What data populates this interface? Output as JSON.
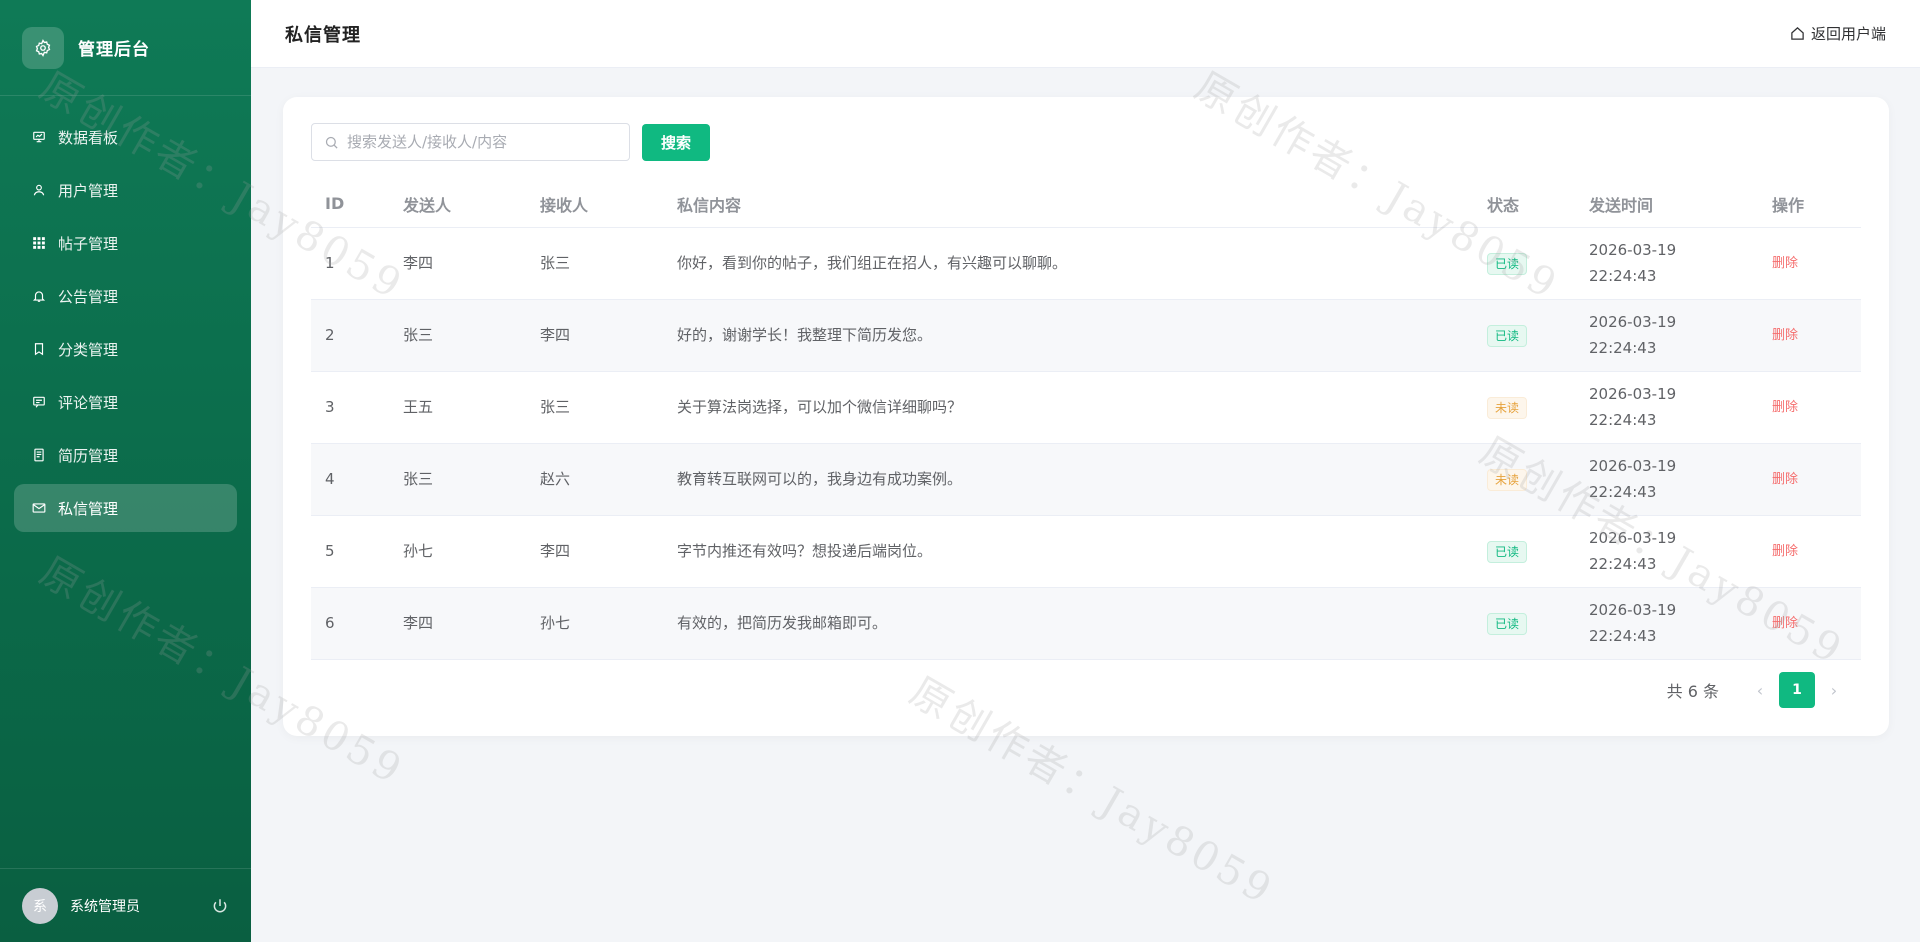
{
  "sidebar": {
    "brand_title": "管理后台",
    "menu": [
      {
        "label": "数据看板",
        "icon": "dashboard-icon",
        "active": false
      },
      {
        "label": "用户管理",
        "icon": "user-icon",
        "active": false
      },
      {
        "label": "帖子管理",
        "icon": "grid-icon",
        "active": false
      },
      {
        "label": "公告管理",
        "icon": "bell-icon",
        "active": false
      },
      {
        "label": "分类管理",
        "icon": "bookmark-icon",
        "active": false
      },
      {
        "label": "评论管理",
        "icon": "comment-icon",
        "active": false
      },
      {
        "label": "简历管理",
        "icon": "document-icon",
        "active": false
      },
      {
        "label": "私信管理",
        "icon": "mail-icon",
        "active": true
      }
    ],
    "avatar_text": "系",
    "admin_name": "系统管理员"
  },
  "header": {
    "title": "私信管理",
    "back_label": "返回用户端"
  },
  "search": {
    "placeholder": "搜索发送人/接收人/内容",
    "value": "",
    "button_label": "搜索"
  },
  "table": {
    "columns": [
      "ID",
      "发送人",
      "接收人",
      "私信内容",
      "状态",
      "发送时间",
      "操作"
    ],
    "rows": [
      {
        "id": "1",
        "sender": "李四",
        "receiver": "张三",
        "content": "你好，看到你的帖子，我们组正在招人，有兴趣可以聊聊。",
        "status": "已读",
        "status_type": "read",
        "date": "2026-03-19",
        "time": "22:24:43",
        "action": "删除"
      },
      {
        "id": "2",
        "sender": "张三",
        "receiver": "李四",
        "content": "好的，谢谢学长！我整理下简历发您。",
        "status": "已读",
        "status_type": "read",
        "date": "2026-03-19",
        "time": "22:24:43",
        "action": "删除"
      },
      {
        "id": "3",
        "sender": "王五",
        "receiver": "张三",
        "content": "关于算法岗选择，可以加个微信详细聊吗？",
        "status": "未读",
        "status_type": "unread",
        "date": "2026-03-19",
        "time": "22:24:43",
        "action": "删除"
      },
      {
        "id": "4",
        "sender": "张三",
        "receiver": "赵六",
        "content": "教育转互联网可以的，我身边有成功案例。",
        "status": "未读",
        "status_type": "unread",
        "date": "2026-03-19",
        "time": "22:24:43",
        "action": "删除"
      },
      {
        "id": "5",
        "sender": "孙七",
        "receiver": "李四",
        "content": "字节内推还有效吗？想投递后端岗位。",
        "status": "已读",
        "status_type": "read",
        "date": "2026-03-19",
        "time": "22:24:43",
        "action": "删除"
      },
      {
        "id": "6",
        "sender": "李四",
        "receiver": "孙七",
        "content": "有效的，把简历发我邮箱即可。",
        "status": "已读",
        "status_type": "read",
        "date": "2026-03-19",
        "time": "22:24:43",
        "action": "删除"
      }
    ]
  },
  "pagination": {
    "total_text": "共 6 条",
    "current_page": "1"
  },
  "watermark": "原创作者：Jay8059",
  "colors": {
    "brand_green": "#0f7a56",
    "accent": "#10b981",
    "danger": "#f56c6c",
    "warning": "#e6a23c"
  }
}
